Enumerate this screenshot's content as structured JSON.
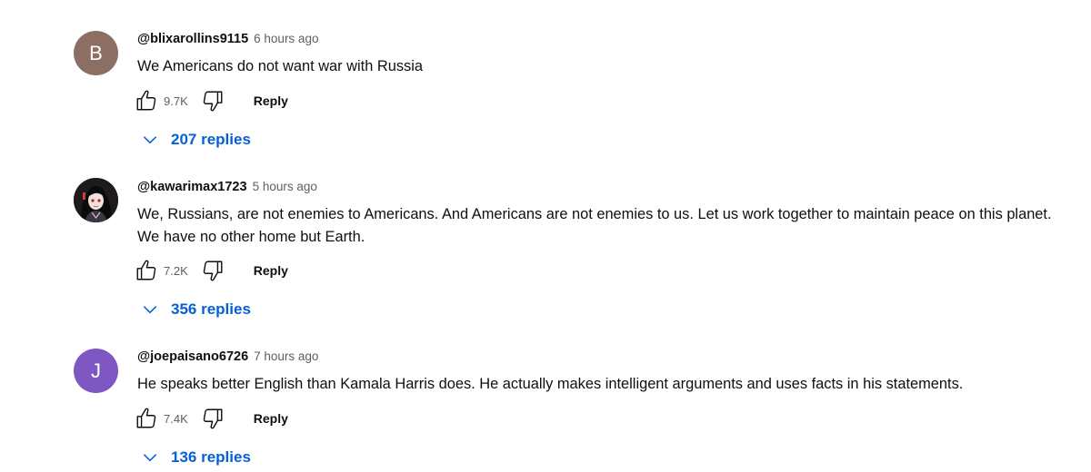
{
  "comments": [
    {
      "avatar_letter": "B",
      "avatar_color": "#8d6e63",
      "author": "@blixarollins9115",
      "time": "6 hours ago",
      "text": "We Americans do not want war with Russia",
      "likes": "9.7K",
      "reply_label": "Reply",
      "replies_label": "207 replies"
    },
    {
      "avatar_letter": "",
      "avatar_image": "anime-portrait",
      "author": "@kawarimax1723",
      "time": "5 hours ago",
      "text": "We, Russians, are not enemies to Americans. And Americans are not enemies to us. Let us work together to maintain peace on this planet. We have no other home but Earth.",
      "likes": "7.2K",
      "reply_label": "Reply",
      "replies_label": "356 replies"
    },
    {
      "avatar_letter": "J",
      "avatar_color": "#7e57c2",
      "author": "@joepaisano6726",
      "time": "7 hours ago",
      "text": "He speaks better English than Kamala Harris does.  He actually makes intelligent arguments and uses facts in his statements.",
      "likes": "7.4K",
      "reply_label": "Reply",
      "replies_label": "136 replies"
    }
  ],
  "colors": {
    "link_blue": "#065fd4",
    "meta_gray": "#606060",
    "text": "#0f0f0f"
  }
}
